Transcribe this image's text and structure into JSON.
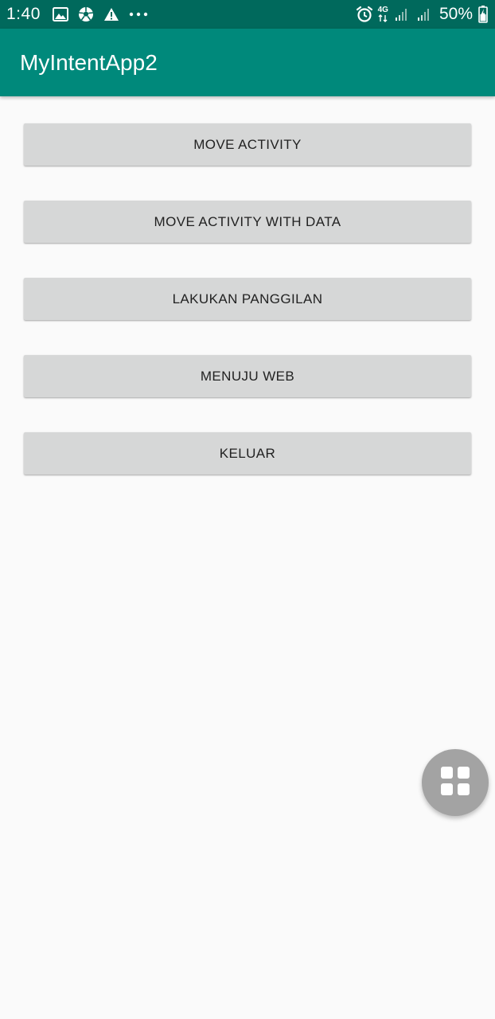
{
  "status_bar": {
    "time": "1:40",
    "icons_left": [
      "image-icon",
      "soccer-ball-icon",
      "warning-icon",
      "more-dots-icon"
    ],
    "more_dots": "···",
    "network_label": "4G",
    "battery_percent": "50%",
    "icons_right": [
      "alarm-icon",
      "network-4g-icon",
      "signal-icon",
      "signal-icon",
      "battery-charging-icon"
    ]
  },
  "app_bar": {
    "title": "MyIntentApp2",
    "color": "#00897b"
  },
  "buttons": [
    {
      "label": "MOVE ACTIVITY"
    },
    {
      "label": "MOVE ACTIVITY WITH DATA"
    },
    {
      "label": "LAKUKAN PANGGILAN"
    },
    {
      "label": "MENUJU WEB"
    },
    {
      "label": "KELUAR"
    }
  ],
  "fab": {
    "icon": "grid-apps-icon",
    "color": "#a3a3a3"
  },
  "colors": {
    "status_bar": "#00695c",
    "app_bar": "#00897b",
    "background": "#fafafa",
    "button": "#d6d7d7"
  }
}
